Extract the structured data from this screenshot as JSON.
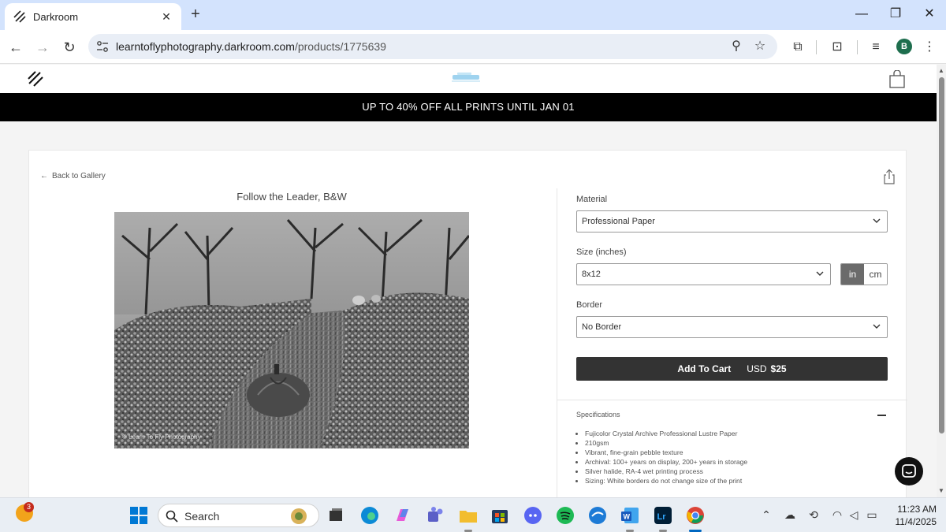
{
  "browser": {
    "tab_title": "Darkroom",
    "url_host": "learntoflyphotography.darkroom.com",
    "url_path": "/products/1775639",
    "profile_initial": "B"
  },
  "site": {
    "promo": "UP TO 40% OFF ALL PRINTS UNTIL JAN 01",
    "back_label": "Back to Gallery",
    "photo_title": "Follow the Leader, B&W",
    "watermark": "© Learn To Fly Photography"
  },
  "options": {
    "material_label": "Material",
    "material_value": "Professional Paper",
    "size_label": "Size (inches)",
    "size_value": "8x12",
    "unit_in": "in",
    "unit_cm": "cm",
    "border_label": "Border",
    "border_value": "No Border"
  },
  "cart": {
    "button_label": "Add To Cart",
    "currency": "USD",
    "price": "$25"
  },
  "specifications": {
    "title": "Specifications",
    "items": [
      "Fujicolor Crystal Archive Professional Lustre Paper",
      "210gsm",
      "Vibrant, fine-grain pebble texture",
      "Archival: 100+ years on display, 200+ years in storage",
      "Silver halide, RA-4 wet printing process",
      "Sizing: White borders do not change size of the print"
    ]
  },
  "taskbar": {
    "search_label": "Search",
    "notification_count": "3",
    "time": "11:23 AM",
    "date": "11/4/2025"
  },
  "colors": {
    "promo_bg": "#000000",
    "button_bg": "#333333",
    "unit_active": "#6b6b6b",
    "chrome_tabstrip": "#d3e3fd"
  }
}
